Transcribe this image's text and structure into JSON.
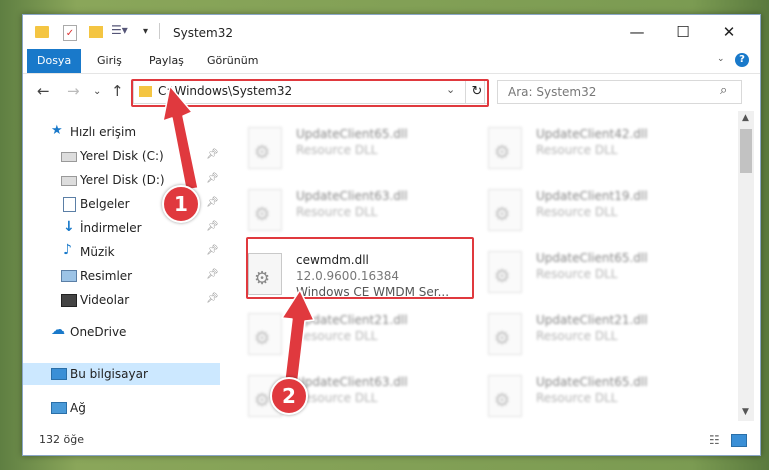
{
  "window": {
    "title": "System32"
  },
  "ribbon": {
    "tabs": [
      "Dosya",
      "Giriş",
      "Paylaş",
      "Görünüm"
    ]
  },
  "address": {
    "path": "C:\\Windows\\System32"
  },
  "search": {
    "placeholder": "Ara: System32"
  },
  "sidebar": {
    "quick_access": "Hızlı erişim",
    "items": [
      "Yerel Disk (C:)",
      "Yerel Disk (D:)",
      "Belgeler",
      "İndirmeler",
      "Müzik",
      "Resimler",
      "Videolar"
    ],
    "onedrive": "OneDrive",
    "this_pc": "Bu bilgisayar",
    "network": "Ağ"
  },
  "files": {
    "highlighted": {
      "name": "cewmdm.dll",
      "version": "12.0.9600.16384",
      "description": "Windows CE WMDM Ser..."
    },
    "left_column": [
      {
        "name": "UpdateClient65.dll",
        "type": "Resource DLL"
      },
      {
        "name": "UpdateClient63.dll",
        "type": "Resource DLL"
      },
      {
        "name": "UpdateClient21.dll",
        "type": "Resource DLL"
      },
      {
        "name": "UpdateClient63.dll",
        "type": "Resource DLL"
      }
    ],
    "right_column": [
      {
        "name": "UpdateClient42.dll",
        "type": "Resource DLL"
      },
      {
        "name": "UpdateClient19.dll",
        "type": "Resource DLL"
      },
      {
        "name": "UpdateClient65.dll",
        "type": "Resource DLL"
      },
      {
        "name": "UpdateClient21.dll",
        "type": "Resource DLL"
      },
      {
        "name": "UpdateClient65.dll",
        "type": "Resource DLL"
      }
    ]
  },
  "status": {
    "count": "132 öğe"
  },
  "annotations": {
    "step1": "1",
    "step2": "2"
  },
  "colors": {
    "accent": "#1979ca",
    "highlight": "#e0393e",
    "selected": "#cce8ff"
  }
}
